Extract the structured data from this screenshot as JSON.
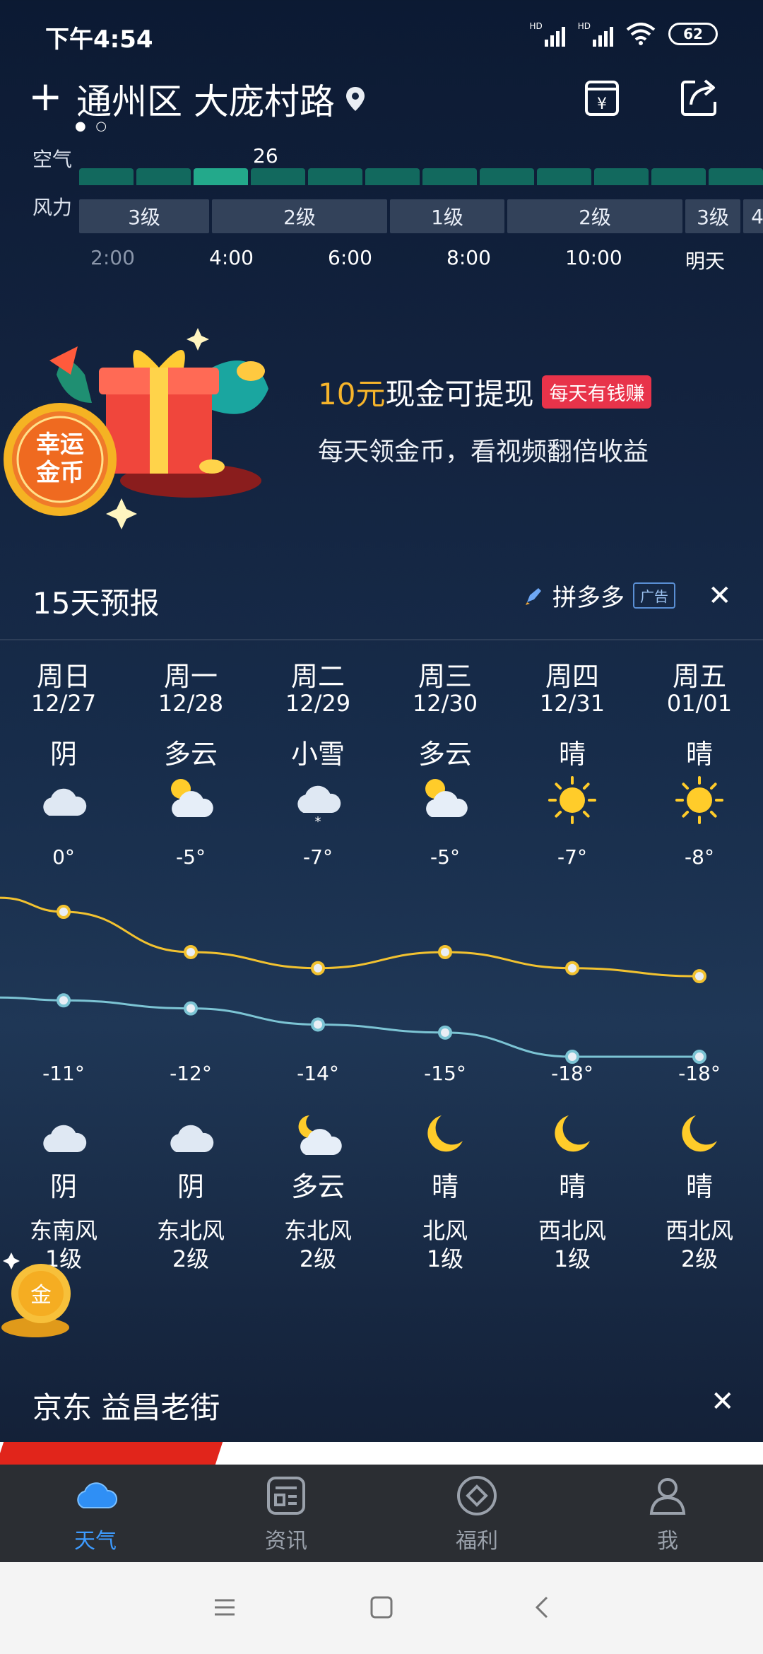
{
  "status": {
    "time": "下午4:54",
    "hd1": "HD",
    "hd2": "HD",
    "battery": "62"
  },
  "header": {
    "add": "+",
    "location": "通州区 大庞村路",
    "dots": "● ○"
  },
  "air": {
    "label": "空气",
    "value": "26"
  },
  "wind": {
    "label": "风力",
    "segments": [
      "3级",
      "2级",
      "1级",
      "2级",
      "3级",
      "4"
    ]
  },
  "times": [
    "2:00",
    "4:00",
    "6:00",
    "8:00",
    "10:00",
    "明天"
  ],
  "promo": {
    "amount": "10元",
    "title_rest": "现金可提现",
    "tag": "每天有钱赚",
    "subtitle": "每天领金币，看视频翻倍收益",
    "coin_text1": "幸运",
    "coin_text2": "金币"
  },
  "forecast": {
    "title": "15天预报",
    "ad_name": "拼多多",
    "ad_badge": "广告",
    "close": "✕",
    "days": [
      {
        "day": "周日",
        "date": "12/27",
        "cond_day": "阴",
        "icon_day": "cloudy-icon",
        "hi": "0°",
        "lo": "-11°",
        "icon_night": "cloudy-icon",
        "cond_night": "阴",
        "wind_dir": "东南风",
        "wind_lv": "1级"
      },
      {
        "day": "周一",
        "date": "12/28",
        "cond_day": "多云",
        "icon_day": "partly-cloudy-icon",
        "hi": "-5°",
        "lo": "-12°",
        "icon_night": "cloudy-icon",
        "cond_night": "阴",
        "wind_dir": "东北风",
        "wind_lv": "2级"
      },
      {
        "day": "周二",
        "date": "12/29",
        "cond_day": "小雪",
        "icon_day": "light-snow-icon",
        "hi": "-7°",
        "lo": "-14°",
        "icon_night": "partly-cloudy-night-icon",
        "cond_night": "多云",
        "wind_dir": "东北风",
        "wind_lv": "2级"
      },
      {
        "day": "周三",
        "date": "12/30",
        "cond_day": "多云",
        "icon_day": "partly-cloudy-icon",
        "hi": "-5°",
        "lo": "-15°",
        "icon_night": "moon-icon",
        "cond_night": "晴",
        "wind_dir": "北风",
        "wind_lv": "1级"
      },
      {
        "day": "周四",
        "date": "12/31",
        "cond_day": "晴",
        "icon_day": "sun-icon",
        "hi": "-7°",
        "lo": "-18°",
        "icon_night": "moon-icon",
        "cond_night": "晴",
        "wind_dir": "西北风",
        "wind_lv": "1级"
      },
      {
        "day": "周五",
        "date": "01/01",
        "cond_day": "晴",
        "icon_day": "sun-icon",
        "hi": "-8°",
        "lo": "-18°",
        "icon_night": "moon-icon",
        "cond_night": "晴",
        "wind_dir": "西北风",
        "wind_lv": "2级"
      }
    ]
  },
  "chart_data": {
    "type": "line",
    "categories": [
      "12/27",
      "12/28",
      "12/29",
      "12/30",
      "12/31",
      "01/01"
    ],
    "series": [
      {
        "values": [
          0,
          -5,
          -7,
          -5,
          -7,
          -8
        ]
      },
      {
        "values": [
          -11,
          -12,
          -14,
          -15,
          -18,
          -18
        ]
      }
    ],
    "colors": [
      "#f2c230",
      "#7cc4d4"
    ]
  },
  "jd": {
    "title": "京东 益昌老街",
    "close": "✕"
  },
  "tabs": [
    {
      "label": "天气",
      "icon": "cloud-icon",
      "active": true
    },
    {
      "label": "资讯",
      "icon": "news-icon",
      "active": false
    },
    {
      "label": "福利",
      "icon": "welfare-icon",
      "active": false
    },
    {
      "label": "我",
      "icon": "user-icon",
      "active": false
    }
  ],
  "colors": {
    "accent": "#3d9bff",
    "promo_amount": "#f6b42b",
    "tag_red": "#e8334a",
    "air_green": "#12695e"
  }
}
